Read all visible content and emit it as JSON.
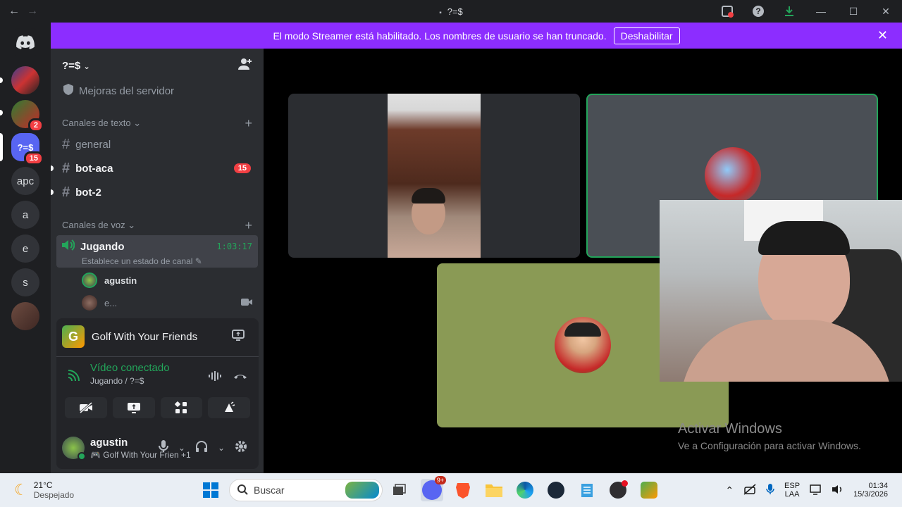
{
  "window": {
    "title": "?=$",
    "back_icon": "←",
    "forward_icon": "→"
  },
  "streamer_banner": {
    "message": "El modo Streamer está habilitado. Los nombres de usuario se han truncado.",
    "button": "Deshabilitar",
    "color": "#8c2dff"
  },
  "guilds": [
    {
      "label": "",
      "badge": ""
    },
    {
      "label": "",
      "badge": "2"
    },
    {
      "label": "?=$",
      "badge": "15"
    },
    {
      "label": "apc",
      "badge": ""
    },
    {
      "label": "a",
      "badge": ""
    },
    {
      "label": "e",
      "badge": ""
    },
    {
      "label": "s",
      "badge": ""
    }
  ],
  "server": {
    "name": "?=$",
    "boost_label": "Mejoras del servidor",
    "text_category": "Canales de texto",
    "voice_category": "Canales de voz",
    "text_channels": [
      {
        "name": "general",
        "badge": ""
      },
      {
        "name": "bot-aca",
        "badge": "15"
      },
      {
        "name": "bot-2",
        "badge": ""
      }
    ],
    "voice_channel": {
      "name": "Jugando",
      "timer": "1:03:17",
      "status_placeholder": "Establece un estado de canal",
      "users": [
        "agustin",
        "e..."
      ]
    }
  },
  "activity": {
    "game": "Golf With Your Friends"
  },
  "voice_connection": {
    "status": "Vídeo conectado",
    "location": "Jugando / ?=$"
  },
  "user": {
    "name": "agustin",
    "status": "Golf With Your Frien",
    "extra": "+1"
  },
  "watermark": {
    "title": "Activar Windows",
    "subtitle": "Ve a Configuración para activar Windows."
  },
  "taskbar": {
    "temperature": "21°C",
    "weather": "Despejado",
    "search_placeholder": "Buscar",
    "discord_badge": "9+",
    "lang1": "ESP",
    "lang2": "LAA",
    "time": "01:34",
    "date": "15/3/2026"
  },
  "colors": {
    "speaking_border": "#23a55a",
    "tile_olive": "#8a9a55",
    "tile_grey": "#4a4f55"
  }
}
